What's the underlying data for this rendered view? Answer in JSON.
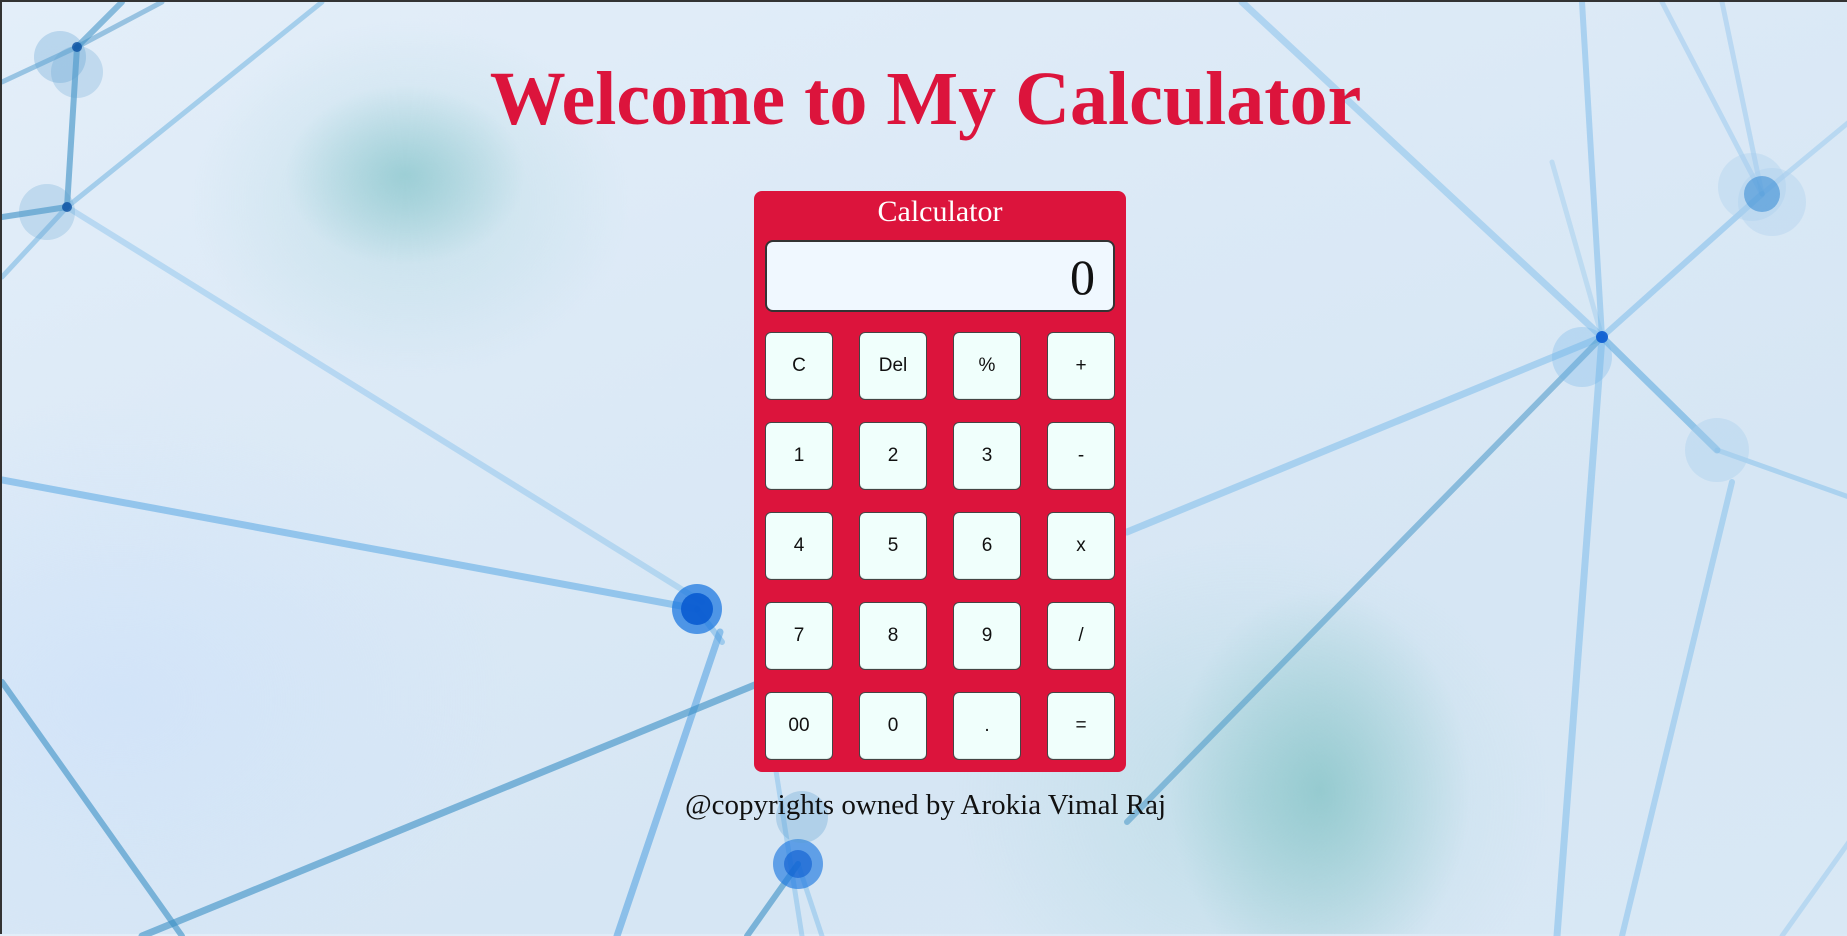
{
  "page": {
    "title": "Welcome to My Calculator",
    "footer": "@copyrights owned by Arokia Vimal Raj"
  },
  "calculator": {
    "title": "Calculator",
    "display_value": "0",
    "keys": [
      {
        "label": "C",
        "name": "clear"
      },
      {
        "label": "Del",
        "name": "delete"
      },
      {
        "label": "%",
        "name": "percent"
      },
      {
        "label": "+",
        "name": "plus"
      },
      {
        "label": "1",
        "name": "1"
      },
      {
        "label": "2",
        "name": "2"
      },
      {
        "label": "3",
        "name": "3"
      },
      {
        "label": "-",
        "name": "minus"
      },
      {
        "label": "4",
        "name": "4"
      },
      {
        "label": "5",
        "name": "5"
      },
      {
        "label": "6",
        "name": "6"
      },
      {
        "label": "x",
        "name": "multiply"
      },
      {
        "label": "7",
        "name": "7"
      },
      {
        "label": "8",
        "name": "8"
      },
      {
        "label": "9",
        "name": "9"
      },
      {
        "label": "/",
        "name": "divide"
      },
      {
        "label": "00",
        "name": "double-zero"
      },
      {
        "label": "0",
        "name": "0"
      },
      {
        "label": ".",
        "name": "decimal"
      },
      {
        "label": "=",
        "name": "equals"
      }
    ]
  },
  "colors": {
    "accent": "#dc143c",
    "display_bg": "#f0f8ff",
    "key_bg": "#f0fffc",
    "network_line": "#3d8fd6",
    "network_node": "#0a5bd0"
  }
}
